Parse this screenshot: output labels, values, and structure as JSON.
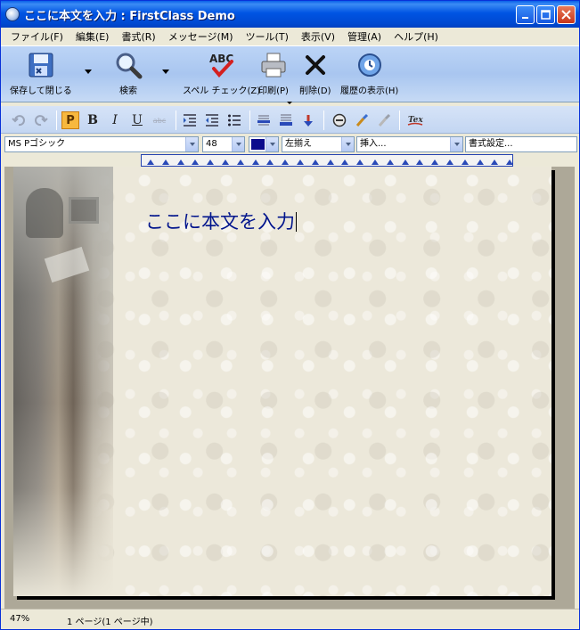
{
  "window": {
    "title": "ここに本文を入力 : FirstClass Demo"
  },
  "menu": [
    "ファイル(F)",
    "編集(E)",
    "書式(R)",
    "メッセージ(M)",
    "ツール(T)",
    "表示(V)",
    "管理(A)",
    "ヘルプ(H)"
  ],
  "toolbar": {
    "save_close": "保存して閉じる",
    "search": "検索",
    "spellcheck": "スペル チェック(Z)",
    "print": "印刷(P)",
    "delete": "削除(D)",
    "history": "履歴の表示(H)"
  },
  "format": {
    "font": "MS Pゴシック",
    "size": "48",
    "color": "#0a0a8c",
    "align": "左揃え",
    "insert": "挿入...",
    "style": "書式設定..."
  },
  "document": {
    "body_text": "ここに本文を入力"
  },
  "status": {
    "zoom": "47%",
    "page": "1 ページ(1 ページ中)"
  }
}
